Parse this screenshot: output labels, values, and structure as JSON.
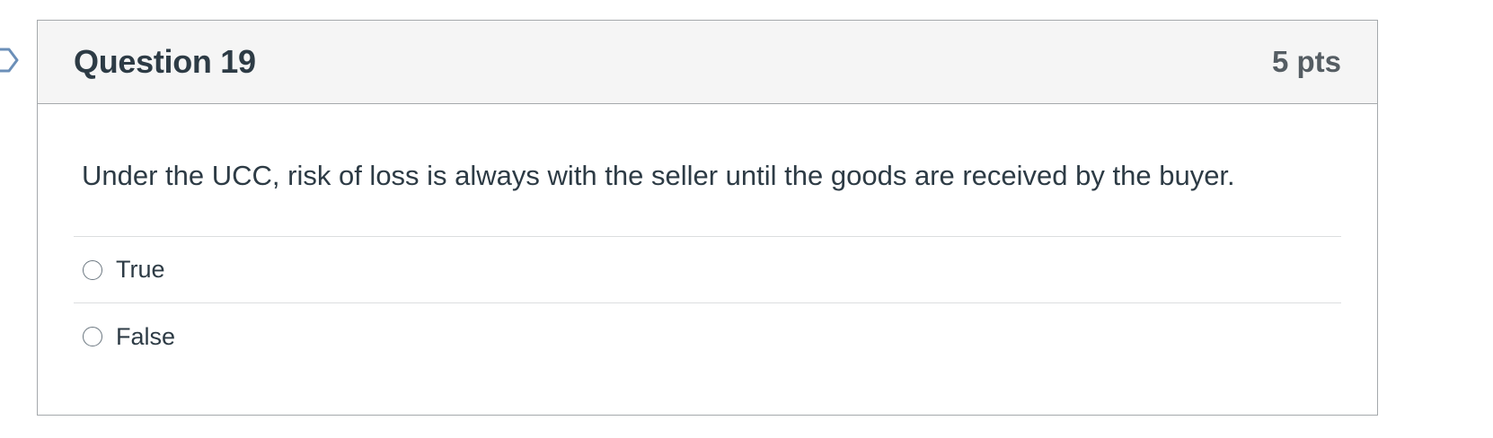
{
  "question": {
    "title": "Question 19",
    "points": "5 pts",
    "text": "Under the UCC, risk of loss is always with the seller until the goods are received by the buyer.",
    "answers": [
      {
        "label": "True",
        "selected": false
      },
      {
        "label": "False",
        "selected": false
      }
    ]
  },
  "colors": {
    "header_bg": "#f5f5f5",
    "border": "#a5a9ac",
    "text": "#2d3b45",
    "flag": "#6b8fb8"
  },
  "icons": {
    "flag": "flag-question-icon"
  }
}
